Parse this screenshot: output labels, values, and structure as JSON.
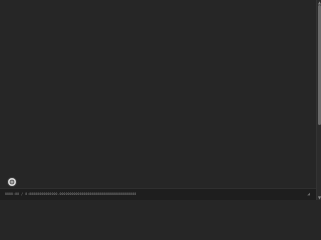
{
  "status_bar": {
    "text": "0000:00 / 0:00000000000000.00000000000000000000000000000000000000",
    "right_icon": "resize-grip-icon"
  },
  "float_button": {
    "icon": "assistant-icon"
  },
  "scrollbar": {
    "up_arrow": "▲",
    "down_arrow": "▼"
  },
  "colors": {
    "background": "#262626",
    "status_bar": "#1e1e1e",
    "button": "#d9d9d9"
  }
}
